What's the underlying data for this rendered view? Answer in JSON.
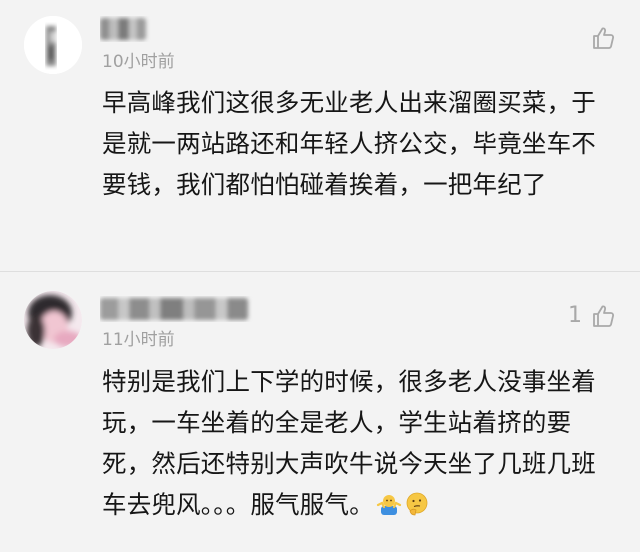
{
  "comments": [
    {
      "username": "",
      "time": "10小时前",
      "like_count": "",
      "text": "早高峰我们这很多无业老人出来溜圈买菜，于是就一两站路还和年轻人挤公交，毕竟坐车不要钱，我们都怕怕碰着挨着，一把年纪了",
      "avatar_icon": "blurred-avatar-icon",
      "like_icon": "thumbs-up-icon"
    },
    {
      "username": "",
      "time": "11小时前",
      "like_count": "1",
      "text": "特别是我们上下学的时候，很多老人没事坐着玩，一车坐着的全是老人，学生站着挤的要死，然后还特别大声吹牛说今天坐了几班几班车去兜风。。。服气服气。",
      "avatar_icon": "blurred-avatar-icon",
      "like_icon": "thumbs-up-icon",
      "trailing_emojis": [
        "shrug-emoji-icon",
        "thinking-emoji-icon"
      ]
    }
  ],
  "colors": {
    "background": "#f3f3f3",
    "text": "#161616",
    "meta": "#a0a0a0",
    "divider": "#dedede"
  }
}
